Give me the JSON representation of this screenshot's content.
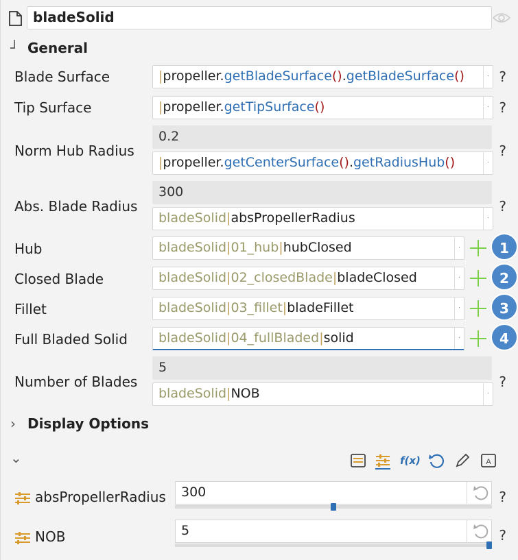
{
  "header": {
    "title": "bladeSolid"
  },
  "general": {
    "heading": "General",
    "chevron": "┘",
    "rows": {
      "blade_surface": {
        "label": "Blade Surface",
        "expr_obj": "propeller.",
        "fn1": "getBladeSurface",
        "p1": "()",
        "dot": ".",
        "fn2": "getBladeSurface",
        "p2": "()"
      },
      "tip_surface": {
        "label": "Tip Surface",
        "expr_obj": "propeller.",
        "fn1": "getTipSurface",
        "p1": "()"
      },
      "norm_hub_radius": {
        "label": "Norm Hub Radius",
        "value": "0.2",
        "expr_obj": "propeller.",
        "fn1": "getCenterSurface",
        "p1": "()",
        "dot": ".",
        "fn2": "getRadiusHub",
        "p2": "()"
      },
      "abs_blade_radius": {
        "label": "Abs. Blade Radius",
        "value": "300",
        "ref": "bladeSolid",
        "bar": "|",
        "param": "absPropellerRadius"
      },
      "hub": {
        "label": "Hub",
        "ref": "bladeSolid",
        "bar": "|",
        "ref2": "01_hub",
        "val": "hubClosed",
        "badge": "1"
      },
      "closed_blade": {
        "label": "Closed Blade",
        "ref": "bladeSolid",
        "bar": "|",
        "ref2": "02_closedBlade",
        "val": "bladeClosed",
        "badge": "2"
      },
      "fillet": {
        "label": "Fillet",
        "ref": "bladeSolid",
        "bar": "|",
        "ref2": "03_fillet",
        "val": "bladeFillet",
        "badge": "3"
      },
      "full_bladed_solid": {
        "label": "Full Bladed Solid",
        "ref": "bladeSolid",
        "bar": "|",
        "ref2": "04_fullBladed",
        "val": "solid",
        "badge": "4"
      },
      "number_of_blades": {
        "label": "Number of Blades",
        "value": "5",
        "ref": "bladeSolid",
        "bar": "|",
        "param": "NOB"
      }
    },
    "help": "?"
  },
  "display_options": {
    "heading": "Display Options",
    "chevron": "›"
  },
  "params_section": {
    "chevron": "⌄"
  },
  "toolbar": {
    "fx_label": "f(x)"
  },
  "params": [
    {
      "name": "absPropellerRadius",
      "value": "300",
      "slider_fraction": 0.5
    },
    {
      "name": "NOB",
      "value": "5",
      "slider_fraction": 1.0
    }
  ],
  "colors": {
    "function": "#2f6fb3",
    "paren": "#a11a1a",
    "reference": "#9a9a6a",
    "badge": "#4a86c8",
    "plus": "#7bd24a"
  }
}
